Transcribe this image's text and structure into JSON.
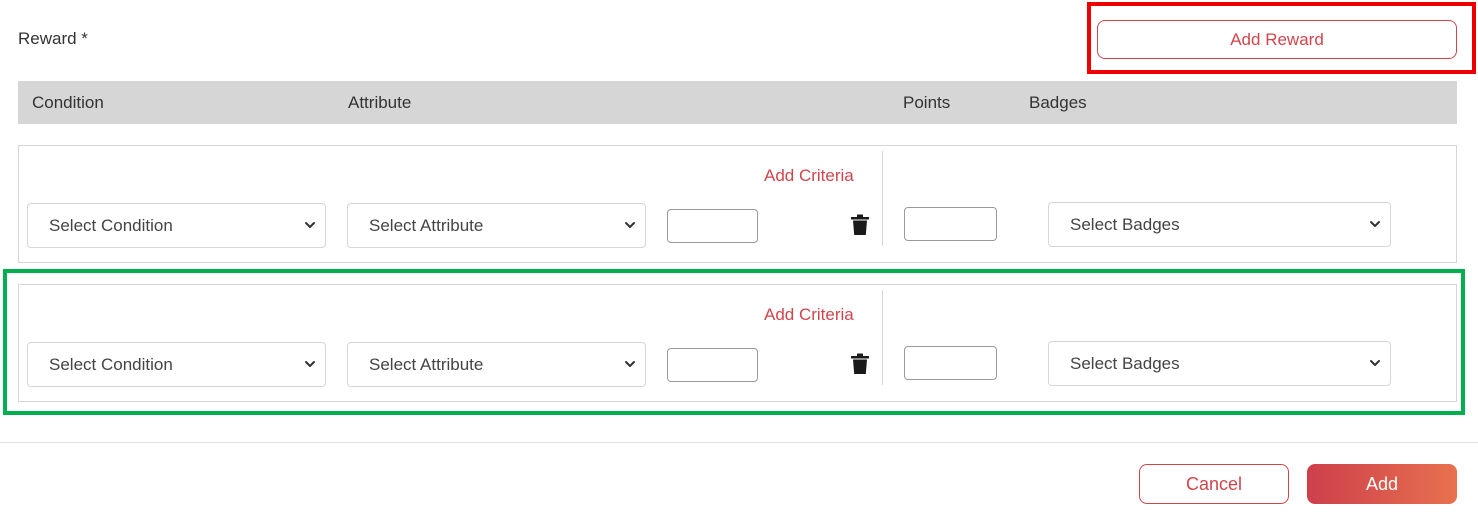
{
  "reward": {
    "label": "Reward *"
  },
  "toolbar": {
    "add_reward_label": "Add Reward"
  },
  "table": {
    "headers": {
      "condition": "Condition",
      "attribute": "Attribute",
      "points": "Points",
      "badges": "Badges"
    }
  },
  "rows": [
    {
      "add_criteria_label": "Add Criteria",
      "condition_select": "Select Condition",
      "attribute_select": "Select Attribute",
      "criteria_value": "",
      "points_value": "",
      "badges_select": "Select Badges"
    },
    {
      "add_criteria_label": "Add Criteria",
      "condition_select": "Select Condition",
      "attribute_select": "Select Attribute",
      "criteria_value": "",
      "points_value": "",
      "badges_select": "Select Badges"
    }
  ],
  "footer": {
    "cancel_label": "Cancel",
    "add_label": "Add"
  },
  "colors": {
    "accent": "#d0454c",
    "highlight_red": "#ee0000",
    "highlight_green": "#00b050",
    "header_bg": "#d6d6d6"
  },
  "icons": {
    "select_arrow": "chevron-down-icon",
    "delete": "trash-icon"
  }
}
